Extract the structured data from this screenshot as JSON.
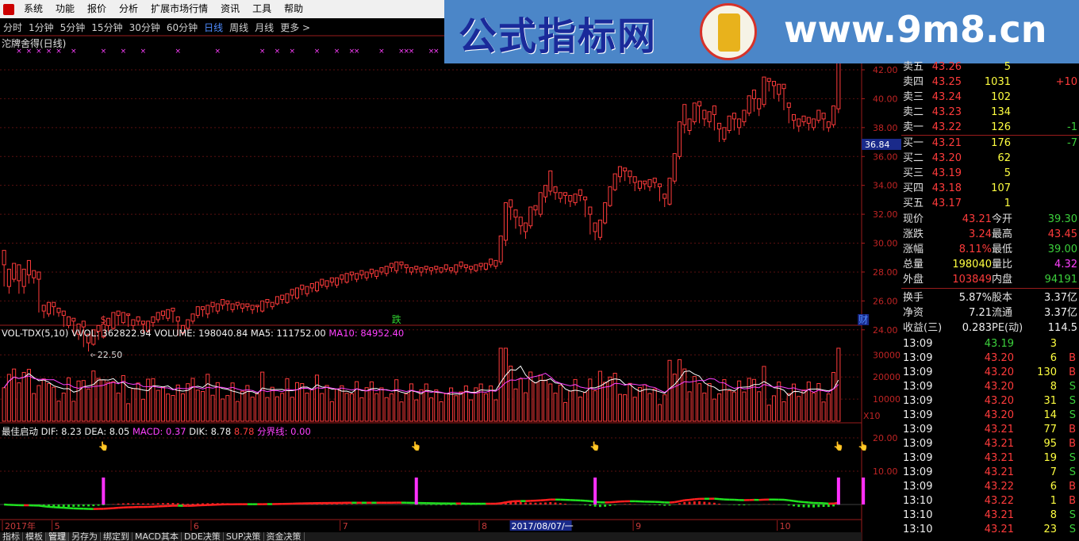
{
  "menu": {
    "items": [
      "系统",
      "功能",
      "报价",
      "分析",
      "扩展市场行情",
      "资讯",
      "工具",
      "帮助"
    ]
  },
  "periods": {
    "items": [
      "分时",
      "1分钟",
      "5分钟",
      "15分钟",
      "30分钟",
      "60分钟",
      "日线",
      "周线",
      "月线",
      "更多 >"
    ],
    "active": 6
  },
  "banner": {
    "title_cn": "公式指标网",
    "url": "www.9m8.cn"
  },
  "chart": {
    "title": "沱牌舍得(日线)",
    "ymax": 42.0,
    "ymin": 23.0,
    "price_ticks": [
      "42.00",
      "40.00",
      "38.00",
      "36.00",
      "34.00",
      "32.00",
      "30.00",
      "28.00",
      "26.00",
      "24.00"
    ],
    "price_tick_values": [
      42,
      40,
      38,
      36,
      34,
      32,
      30,
      28,
      26,
      24
    ],
    "cursor_price": "36.84",
    "low_marker": "←22.50",
    "low_value": 22.5,
    "markers": [
      {
        "t": "$",
        "color": "#ff4040",
        "i": 20
      },
      {
        "t": "跌",
        "color": "#30d030",
        "i": 79
      },
      {
        "t": "财",
        "color": "#4f8cff",
        "i": 173
      }
    ],
    "candles": [
      [
        28.5,
        29.5,
        27,
        27
      ],
      [
        27,
        28.2,
        26.5,
        27.8
      ],
      [
        27.5,
        28.6,
        27.3,
        27.4
      ],
      [
        27.4,
        28.5,
        26.5,
        27.4
      ],
      [
        27,
        28.2,
        26.5,
        27.5
      ],
      [
        27.8,
        28.8,
        27.2,
        27.6
      ],
      [
        27.6,
        28.1,
        27.2,
        27.4
      ],
      [
        27.5,
        28.0,
        25.2,
        25.3
      ],
      [
        25.3,
        25.7,
        24.8,
        25.2
      ],
      [
        25.1,
        25.9,
        24.9,
        25.6
      ],
      [
        25.6,
        25.9,
        25.0,
        25.2
      ],
      [
        25.2,
        25.5,
        24.9,
        25.0
      ],
      [
        25,
        25.3,
        24.2,
        24.3
      ],
      [
        24.3,
        24.9,
        24.1,
        24.6
      ],
      [
        24.6,
        24.8,
        23.6,
        23.7
      ],
      [
        23.7,
        24.4,
        23.3,
        24.2
      ],
      [
        24.2,
        24.6,
        22.8,
        23.1
      ],
      [
        23.1,
        23.7,
        22.5,
        23.0
      ],
      [
        23,
        24.0,
        22.9,
        23.9
      ],
      [
        23.9,
        24.3,
        23.3,
        23.5
      ],
      [
        23.5,
        24.4,
        23.4,
        24.3
      ],
      [
        24.3,
        24.8,
        23.9,
        24.1
      ],
      [
        24.1,
        25.2,
        24.0,
        25.0
      ],
      [
        25,
        25.3,
        24.3,
        24.5
      ],
      [
        24.5,
        25.2,
        24.4,
        25.0
      ],
      [
        25.0,
        25.1,
        24.2,
        24.3
      ],
      [
        24.3,
        24.7,
        24.0,
        24.6
      ],
      [
        24.6,
        24.9,
        24.3,
        24.4
      ],
      [
        24.4,
        24.6,
        23.8,
        23.9
      ],
      [
        23.9,
        24.6,
        23.8,
        24.5
      ],
      [
        24.5,
        24.9,
        24.2,
        24.7
      ],
      [
        24.7,
        25.2,
        24.5,
        25.0
      ],
      [
        25,
        25.3,
        24.7,
        24.8
      ],
      [
        24.8,
        25.4,
        24.6,
        25.3
      ],
      [
        25.3,
        25.5,
        24.5,
        24.6
      ],
      [
        24.6,
        24.9,
        23.6,
        23.8
      ],
      [
        23.8,
        24.3,
        23.6,
        24.1
      ],
      [
        24.1,
        24.7,
        24.0,
        24.6
      ],
      [
        24.6,
        25.1,
        24.4,
        25.0
      ],
      [
        25,
        25.6,
        24.8,
        25.4
      ],
      [
        25.4,
        25.6,
        24.9,
        25.1
      ],
      [
        25.1,
        25.7,
        24.8,
        25.6
      ],
      [
        25.6,
        25.9,
        25.2,
        25.3
      ],
      [
        25.3,
        25.8,
        25.1,
        25.7
      ],
      [
        25.7,
        26.1,
        25.4,
        25.8
      ],
      [
        25.8,
        26.0,
        25.3,
        25.4
      ],
      [
        25.4,
        25.8,
        25.2,
        25.7
      ],
      [
        25.7,
        25.9,
        25.4,
        25.5
      ],
      [
        25.5,
        25.8,
        25.2,
        25.6
      ],
      [
        25.6,
        25.8,
        25.3,
        25.4
      ],
      [
        25.4,
        25.7,
        25.1,
        25.6
      ],
      [
        25.6,
        25.7,
        25.2,
        25.3
      ],
      [
        25.3,
        26.0,
        25.2,
        25.9
      ],
      [
        25.9,
        26.1,
        25.5,
        25.6
      ],
      [
        25.6,
        25.9,
        25.4,
        25.8
      ],
      [
        25.8,
        26.3,
        25.7,
        26.1
      ],
      [
        26.1,
        26.4,
        25.8,
        25.9
      ],
      [
        25.9,
        26.5,
        25.8,
        26.4
      ],
      [
        26.4,
        26.8,
        26.1,
        26.2
      ],
      [
        26.2,
        26.9,
        26.1,
        26.8
      ],
      [
        26.8,
        27.1,
        26.4,
        26.5
      ],
      [
        26.5,
        27.0,
        26.3,
        26.9
      ],
      [
        26.9,
        27.2,
        26.6,
        26.7
      ],
      [
        26.7,
        27.3,
        26.6,
        27.1
      ],
      [
        27.1,
        27.5,
        26.9,
        27.0
      ],
      [
        27,
        27.4,
        26.8,
        27.3
      ],
      [
        27.3,
        27.6,
        27.0,
        27.1
      ],
      [
        27.1,
        27.6,
        26.9,
        27.5
      ],
      [
        27.5,
        27.8,
        27.2,
        27.3
      ],
      [
        27.3,
        27.9,
        27.2,
        27.8
      ],
      [
        27.8,
        28.0,
        27.4,
        27.5
      ],
      [
        27.5,
        27.9,
        27.3,
        27.8
      ],
      [
        27.8,
        28.1,
        27.5,
        27.6
      ],
      [
        27.6,
        28.0,
        27.4,
        27.9
      ],
      [
        27.9,
        28.2,
        27.6,
        27.7
      ],
      [
        27.7,
        28.1,
        27.5,
        28.0
      ],
      [
        28,
        28.3,
        27.8,
        27.9
      ],
      [
        27.9,
        28.4,
        27.7,
        28.3
      ],
      [
        28.3,
        28.6,
        28.0,
        28.1
      ],
      [
        28.1,
        28.7,
        27.9,
        28.5
      ],
      [
        28.5,
        28.7,
        28.2,
        28.3
      ],
      [
        28.3,
        28.5,
        27.9,
        28.0
      ],
      [
        28.0,
        28.3,
        27.8,
        28.2
      ],
      [
        28.2,
        28.4,
        27.9,
        28.0
      ],
      [
        28.0,
        28.3,
        27.7,
        28.2
      ],
      [
        28.2,
        28.4,
        27.9,
        28.1
      ],
      [
        28.1,
        28.3,
        27.8,
        28.2
      ],
      [
        28.2,
        28.4,
        27.9,
        28.0
      ],
      [
        28.0,
        28.3,
        27.9,
        28.2
      ],
      [
        28.2,
        28.5,
        28.0,
        28.1
      ],
      [
        28.1,
        28.3,
        27.9,
        28.0
      ],
      [
        28.0,
        28.5,
        27.8,
        28.4
      ],
      [
        28.4,
        28.7,
        28.2,
        28.3
      ],
      [
        28.3,
        28.5,
        28.0,
        28.2
      ],
      [
        28.2,
        28.4,
        27.9,
        28.1
      ],
      [
        28.1,
        28.5,
        28.0,
        28.4
      ],
      [
        28.4,
        28.6,
        28.1,
        28.2
      ],
      [
        28.2,
        28.6,
        28.1,
        28.5
      ],
      [
        28.5,
        28.9,
        28.3,
        28.4
      ],
      [
        28.4,
        28.8,
        28.2,
        28.7
      ],
      [
        28.7,
        30.5,
        28.5,
        30.2
      ],
      [
        30.2,
        32.8,
        29.8,
        32.5
      ],
      [
        32.5,
        33.0,
        31.6,
        31.8
      ],
      [
        31.8,
        32.3,
        31.0,
        31.2
      ],
      [
        31.2,
        31.8,
        30.6,
        30.8
      ],
      [
        30.8,
        31.4,
        30.3,
        31.2
      ],
      [
        31.2,
        32.5,
        31.0,
        32.3
      ],
      [
        32.3,
        32.6,
        31.9,
        32.0
      ],
      [
        32,
        33.5,
        31.8,
        33.2
      ],
      [
        33.2,
        34.0,
        32.8,
        33.6
      ],
      [
        33.6,
        35.0,
        33.3,
        33.5
      ],
      [
        33.5,
        33.9,
        33.0,
        33.1
      ],
      [
        33.1,
        33.5,
        32.8,
        33.3
      ],
      [
        33.3,
        33.5,
        32.7,
        32.9
      ],
      [
        32.9,
        33.3,
        32.5,
        32.8
      ],
      [
        32.8,
        33.4,
        32.6,
        33.3
      ],
      [
        33.3,
        33.7,
        32.9,
        33.0
      ],
      [
        33,
        33.2,
        31.8,
        32.0
      ],
      [
        32,
        32.5,
        30.6,
        30.8
      ],
      [
        30.8,
        31.4,
        30.2,
        30.4
      ],
      [
        30.4,
        31.6,
        30.2,
        31.4
      ],
      [
        31.4,
        32.8,
        31.3,
        32.6
      ],
      [
        32.6,
        33.9,
        32.5,
        33.7
      ],
      [
        33.7,
        34.8,
        33.6,
        34.6
      ],
      [
        34.6,
        35.3,
        34.2,
        35.0
      ],
      [
        35,
        35.2,
        34.3,
        34.6
      ],
      [
        34.6,
        35.0,
        34.1,
        34.2
      ],
      [
        34.2,
        34.6,
        33.6,
        33.8
      ],
      [
        33.8,
        34.3,
        33.6,
        34.1
      ],
      [
        34.1,
        34.3,
        33.7,
        33.9
      ],
      [
        33.9,
        34.4,
        33.6,
        34.2
      ],
      [
        34.2,
        34.5,
        33.8,
        33.9
      ],
      [
        33.9,
        34.1,
        32.9,
        33.1
      ],
      [
        33.1,
        33.4,
        32.5,
        32.7
      ],
      [
        32.7,
        34.5,
        32.6,
        34.3
      ],
      [
        34.3,
        36.2,
        34.1,
        36.0
      ],
      [
        36,
        38.4,
        35.8,
        38.2
      ],
      [
        38.2,
        39.6,
        37.6,
        37.8
      ],
      [
        37.8,
        38.6,
        37.5,
        38.4
      ],
      [
        38.4,
        39.7,
        38.2,
        39.5
      ],
      [
        39.5,
        39.8,
        38.3,
        38.6
      ],
      [
        38.6,
        39.2,
        38.1,
        38.4
      ],
      [
        38.4,
        39.1,
        38.0,
        38.9
      ],
      [
        38.9,
        39.5,
        37.8,
        37.9
      ],
      [
        37.9,
        38.3,
        37.0,
        37.2
      ],
      [
        37.2,
        38.0,
        37.0,
        37.8
      ],
      [
        37.8,
        38.8,
        37.6,
        38.6
      ],
      [
        38.6,
        39.0,
        37.8,
        38.0
      ],
      [
        38,
        38.6,
        37.5,
        38.4
      ],
      [
        38.4,
        39.2,
        38.1,
        39.0
      ],
      [
        39,
        40.2,
        38.8,
        40.0
      ],
      [
        40,
        40.6,
        39.1,
        39.3
      ],
      [
        39.3,
        40.0,
        38.8,
        39.6
      ],
      [
        39.6,
        41.5,
        39.4,
        41.2
      ],
      [
        41.2,
        41.4,
        40.5,
        40.9
      ],
      [
        40.9,
        41.2,
        40.0,
        40.3
      ],
      [
        40.3,
        41.0,
        39.8,
        40.7
      ],
      [
        40.7,
        41.0,
        39.2,
        39.4
      ],
      [
        39.4,
        39.7,
        38.3,
        38.5
      ],
      [
        38.5,
        38.9,
        37.9,
        38.1
      ],
      [
        38.1,
        38.6,
        37.7,
        38.4
      ],
      [
        38.4,
        38.8,
        38.1,
        38.3
      ],
      [
        38.3,
        38.7,
        37.8,
        38.0
      ],
      [
        38,
        38.6,
        37.8,
        38.5
      ],
      [
        38.5,
        39.2,
        38.3,
        38.6
      ],
      [
        38.6,
        39.0,
        37.8,
        38.0
      ],
      [
        38,
        38.4,
        37.7,
        38.2
      ],
      [
        38.2,
        39.5,
        38.0,
        39.3
      ],
      [
        39.3,
        42.5,
        39.0,
        42.4
      ]
    ],
    "vol_ticks": [
      "30000",
      "20000",
      "10000"
    ],
    "vol_tick_values": [
      30000,
      20000,
      10000
    ],
    "vol_unit": "X10",
    "macd_ticks": [
      "20.00",
      "10.00"
    ],
    "macd_tick_values": [
      20,
      10
    ],
    "date_labels": [
      {
        "t": "2017年",
        "i": 0
      },
      {
        "t": "5",
        "i": 10
      },
      {
        "t": "6",
        "i": 38
      },
      {
        "t": "7",
        "i": 68
      },
      {
        "t": "8",
        "i": 96
      },
      {
        "t": "2017/08/07/一",
        "i": 102,
        "hl": true
      },
      {
        "t": "9",
        "i": 127
      },
      {
        "t": "10",
        "i": 156
      }
    ]
  },
  "indicators": {
    "vol": {
      "name": "VOL-TDX(5,10)",
      "vvol": "VVOL: 362822.94",
      "volume": "VOLUME: 198040.84",
      "ma5": "MA5: 111752.00",
      "ma10": "MA10: 84952.40"
    },
    "macd": {
      "name": "最佳启动",
      "dif": "DIF: 8.23",
      "dea": "DEA: 8.05",
      "macd": "MACD: 0.37",
      "dik": "DIK: 8.78",
      "dik2": "8.78",
      "boundary": "分界线: 0.00"
    }
  },
  "quote": {
    "asks": [
      {
        "l": "卖五",
        "p": "43.26",
        "v": "5",
        "c": ""
      },
      {
        "l": "卖四",
        "p": "43.25",
        "v": "1031",
        "c": "+10"
      },
      {
        "l": "卖三",
        "p": "43.24",
        "v": "102",
        "c": ""
      },
      {
        "l": "卖二",
        "p": "43.23",
        "v": "134",
        "c": ""
      },
      {
        "l": "卖一",
        "p": "43.22",
        "v": "126",
        "c": "-1"
      }
    ],
    "bids": [
      {
        "l": "买一",
        "p": "43.21",
        "v": "176",
        "c": "-7"
      },
      {
        "l": "买二",
        "p": "43.20",
        "v": "62",
        "c": ""
      },
      {
        "l": "买三",
        "p": "43.19",
        "v": "5",
        "c": ""
      },
      {
        "l": "买四",
        "p": "43.18",
        "v": "107",
        "c": ""
      },
      {
        "l": "买五",
        "p": "43.17",
        "v": "1",
        "c": ""
      }
    ],
    "stats": [
      {
        "l1": "现价",
        "v1": "43.21",
        "l2": "今开",
        "v2": "39.30",
        "c1": "red",
        "c2": "green"
      },
      {
        "l1": "涨跌",
        "v1": "3.24",
        "l2": "最高",
        "v2": "43.45",
        "c1": "red",
        "c2": "red"
      },
      {
        "l1": "涨幅",
        "v1": "8.11%",
        "l2": "最低",
        "v2": "39.00",
        "c1": "red",
        "c2": "green"
      },
      {
        "l1": "总量",
        "v1": "198040",
        "l2": "量比",
        "v2": "4.32",
        "c1": "yellow",
        "c2": "magenta"
      },
      {
        "l1": "外盘",
        "v1": "103849",
        "l2": "内盘",
        "v2": "94191",
        "c1": "red",
        "c2": "green"
      },
      {
        "l1": "换手",
        "v1": "5.87%",
        "l2": "股本",
        "v2": "3.37亿",
        "c1": "white",
        "c2": "white"
      },
      {
        "l1": "净资",
        "v1": "7.21",
        "l2": "流通",
        "v2": "3.37亿",
        "c1": "white",
        "c2": "white"
      },
      {
        "l1": "收益(三)",
        "v1": "0.283",
        "l2": "PE(动)",
        "v2": "114.5",
        "c1": "white",
        "c2": "white"
      }
    ],
    "ticks": [
      {
        "t": "13:09",
        "p": "43.19",
        "v": "3",
        "s": "",
        "pc": "green"
      },
      {
        "t": "13:09",
        "p": "43.20",
        "v": "6",
        "s": "B",
        "pc": "red"
      },
      {
        "t": "13:09",
        "p": "43.20",
        "v": "130",
        "s": "B",
        "pc": "red"
      },
      {
        "t": "13:09",
        "p": "43.20",
        "v": "8",
        "s": "S",
        "pc": "red"
      },
      {
        "t": "13:09",
        "p": "43.20",
        "v": "31",
        "s": "S",
        "pc": "red"
      },
      {
        "t": "13:09",
        "p": "43.20",
        "v": "14",
        "s": "S",
        "pc": "red"
      },
      {
        "t": "13:09",
        "p": "43.21",
        "v": "77",
        "s": "B",
        "pc": "red"
      },
      {
        "t": "13:09",
        "p": "43.21",
        "v": "95",
        "s": "B",
        "pc": "red"
      },
      {
        "t": "13:09",
        "p": "43.21",
        "v": "19",
        "s": "S",
        "pc": "red"
      },
      {
        "t": "13:09",
        "p": "43.21",
        "v": "7",
        "s": "S",
        "pc": "red"
      },
      {
        "t": "13:09",
        "p": "43.22",
        "v": "6",
        "s": "B",
        "pc": "red"
      },
      {
        "t": "13:10",
        "p": "43.22",
        "v": "1",
        "s": "B",
        "pc": "red"
      },
      {
        "t": "13:10",
        "p": "43.21",
        "v": "8",
        "s": "S",
        "pc": "red"
      },
      {
        "t": "13:10",
        "p": "43.21",
        "v": "23",
        "s": "S",
        "pc": "red"
      }
    ]
  },
  "bottom_tabs": {
    "items": [
      "指标",
      "模板",
      "管理",
      "另存为",
      "绑定到",
      "MACD其本",
      "DDE决策",
      "SUP决策",
      "资金决策"
    ],
    "active": 2
  }
}
